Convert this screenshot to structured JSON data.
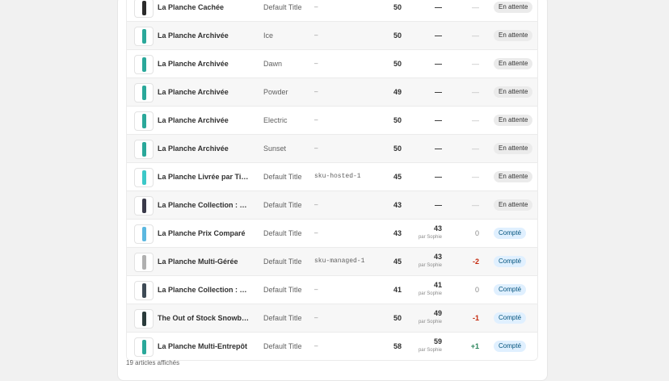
{
  "colors": {
    "page_bg": "#f1f1f1",
    "badge_pending_bg": "#ebebeb",
    "badge_counted_bg": "#e0f0ff",
    "negative": "#c5280c",
    "positive": "#29845a"
  },
  "rows": [
    {
      "name": "La Planche Cachée",
      "variant": "Default Title",
      "sku": "–",
      "available": "50",
      "counted": "—",
      "counted_by": "",
      "diff": "—",
      "status": "En attente",
      "board": "#2b2b2b"
    },
    {
      "name": "La Planche Archivée",
      "variant": "Ice",
      "sku": "–",
      "available": "50",
      "counted": "—",
      "counted_by": "",
      "diff": "—",
      "status": "En attente",
      "board": "#2aa89a"
    },
    {
      "name": "La Planche Archivée",
      "variant": "Dawn",
      "sku": "–",
      "available": "50",
      "counted": "—",
      "counted_by": "",
      "diff": "—",
      "status": "En attente",
      "board": "#2aa89a"
    },
    {
      "name": "La Planche Archivée",
      "variant": "Powder",
      "sku": "–",
      "available": "49",
      "counted": "—",
      "counted_by": "",
      "diff": "—",
      "status": "En attente",
      "board": "#2aa89a"
    },
    {
      "name": "La Planche Archivée",
      "variant": "Electric",
      "sku": "–",
      "available": "50",
      "counted": "—",
      "counted_by": "",
      "diff": "—",
      "status": "En attente",
      "board": "#2aa89a"
    },
    {
      "name": "La Planche Archivée",
      "variant": "Sunset",
      "sku": "–",
      "available": "50",
      "counted": "—",
      "counted_by": "",
      "diff": "—",
      "status": "En attente",
      "board": "#2aa89a"
    },
    {
      "name": "La Planche Livrée par Tiers",
      "variant": "Default Title",
      "sku": "sku-hosted-1",
      "available": "45",
      "counted": "—",
      "counted_by": "",
      "diff": "—",
      "status": "En attente",
      "board": "#3cc8c8"
    },
    {
      "name": "La Planche Collection : Oxygène",
      "variant": "Default Title",
      "sku": "–",
      "available": "43",
      "counted": "—",
      "counted_by": "",
      "diff": "—",
      "status": "En attente",
      "board": "#3a3a4a"
    },
    {
      "name": "La Planche Prix Comparé",
      "variant": "Default Title",
      "sku": "–",
      "available": "43",
      "counted": "43",
      "counted_by": "par Sophie",
      "diff": "0",
      "status": "Compté",
      "board": "#5bb8e0"
    },
    {
      "name": "La Planche Multi-Gérée",
      "variant": "Default Title",
      "sku": "sku-managed-1",
      "available": "45",
      "counted": "43",
      "counted_by": "par Sophie",
      "diff": "-2",
      "status": "Compté",
      "board": "#b0b0b0"
    },
    {
      "name": "La Planche Collection : Liquide",
      "variant": "Default Title",
      "sku": "–",
      "available": "41",
      "counted": "41",
      "counted_by": "par Sophie",
      "diff": "0",
      "status": "Compté",
      "board": "#3d4a55"
    },
    {
      "name": "The Out of Stock Snowboard",
      "variant": "Default Title",
      "sku": "–",
      "available": "50",
      "counted": "49",
      "counted_by": "par Sophie",
      "diff": "-1",
      "status": "Compté",
      "board": "#2a3b3b"
    },
    {
      "name": "La Planche Multi-Entrepôt",
      "variant": "Default Title",
      "sku": "–",
      "available": "58",
      "counted": "59",
      "counted_by": "par Sophie",
      "diff": "+1",
      "status": "Compté",
      "board": "#2aa89a"
    }
  ],
  "footer": {
    "count_text": "19 articles affichés"
  }
}
